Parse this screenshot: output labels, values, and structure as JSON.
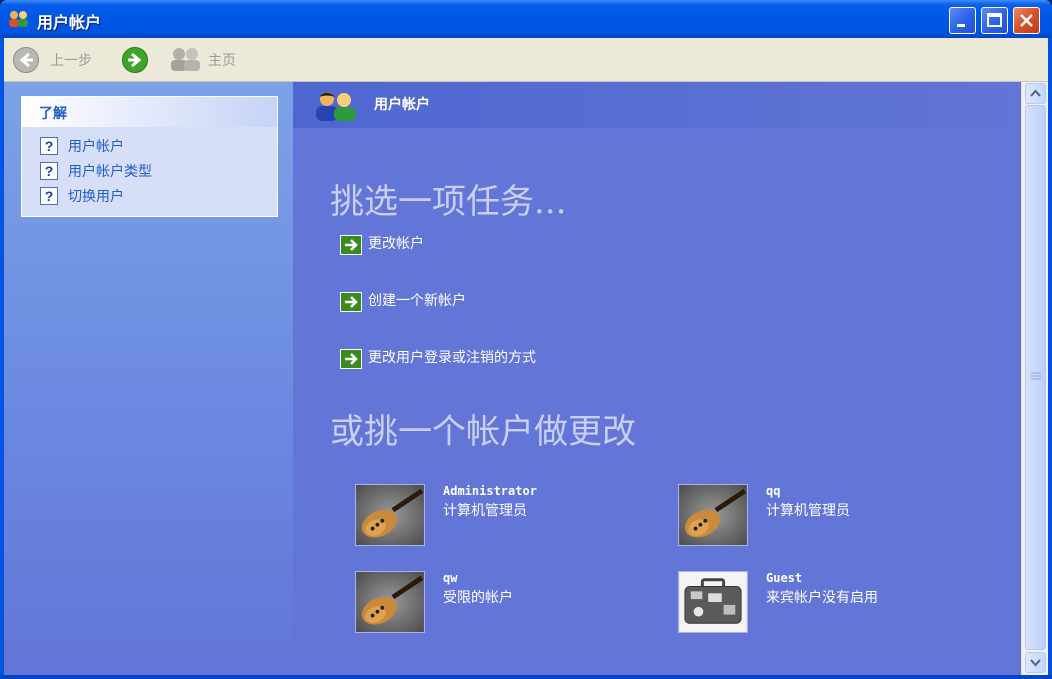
{
  "window": {
    "title": "用户帐户"
  },
  "toolbar": {
    "back_label": "上一步",
    "home_label": "主页"
  },
  "sidebar": {
    "learn_title": "了解",
    "items": [
      {
        "label": "用户帐户"
      },
      {
        "label": "用户帐户类型"
      },
      {
        "label": "切换用户"
      }
    ]
  },
  "main": {
    "header_title": "用户帐户",
    "pick_task_heading": "挑选一项任务...",
    "tasks": [
      {
        "label": "更改帐户"
      },
      {
        "label": "创建一个新帐户"
      },
      {
        "label": "更改用户登录或注销的方式"
      }
    ],
    "pick_account_heading": "或挑一个帐户做更改",
    "accounts": [
      {
        "name": "Administrator",
        "type": "计算机管理员",
        "picture": "guitar"
      },
      {
        "name": "qq",
        "type": "计算机管理员",
        "picture": "guitar"
      },
      {
        "name": "qw",
        "type": "受限的帐户",
        "picture": "guitar"
      },
      {
        "name": "Guest",
        "type": "来宾帐户没有启用",
        "picture": "suitcase"
      }
    ]
  },
  "icons": {
    "back": "back-arrow-icon",
    "forward": "forward-arrow-icon",
    "home": "users-home-icon",
    "help": "help-question-icon",
    "task": "green-arrow-icon"
  },
  "colors": {
    "titlebar": "#0054e3",
    "content_bg": "#6375d6",
    "link_blue": "#215dc6",
    "task_arrow": "#3a8a1c"
  }
}
